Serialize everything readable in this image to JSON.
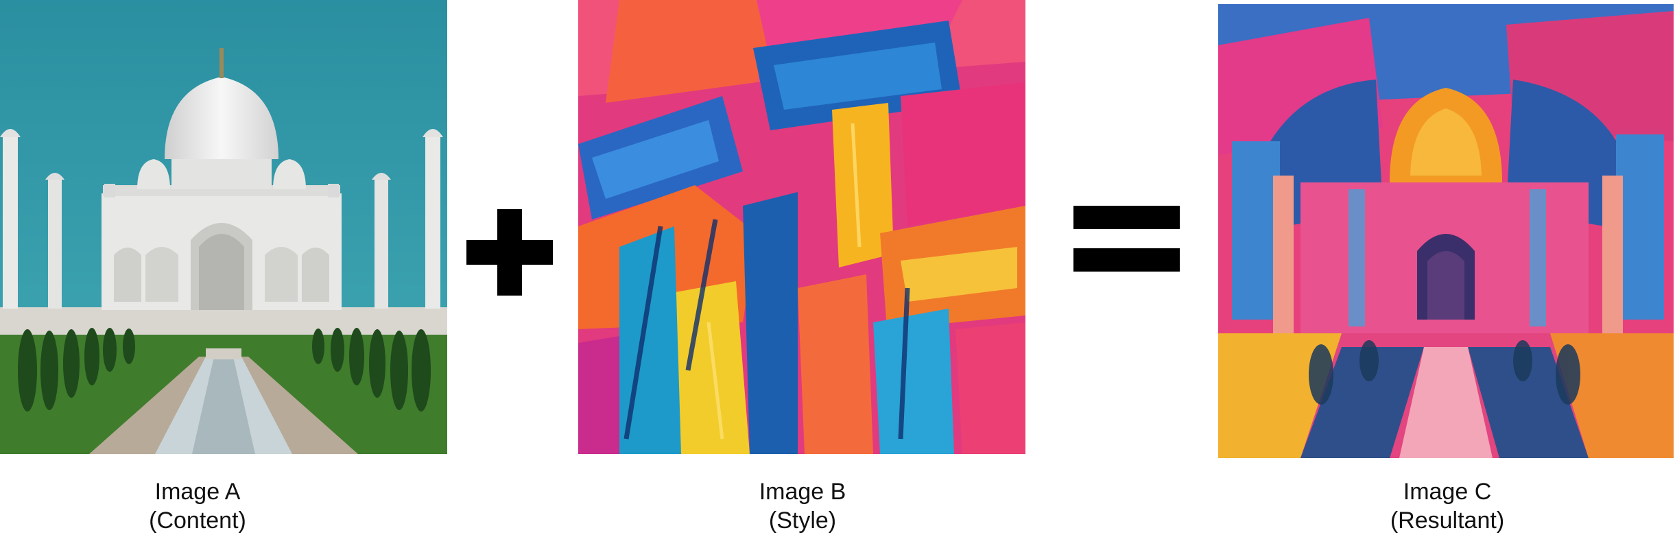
{
  "panels": [
    {
      "id": "A",
      "title": "Image A",
      "subtitle": "(Content)"
    },
    {
      "id": "B",
      "title": "Image B",
      "subtitle": "(Style)"
    },
    {
      "id": "C",
      "title": "Image C",
      "subtitle": "(Resultant)"
    }
  ],
  "colors": {
    "sky": "#2b97a6",
    "marble": "#ececec",
    "grass": "#3d7a2a",
    "operator": "#000000",
    "caption_text": "#111111"
  }
}
